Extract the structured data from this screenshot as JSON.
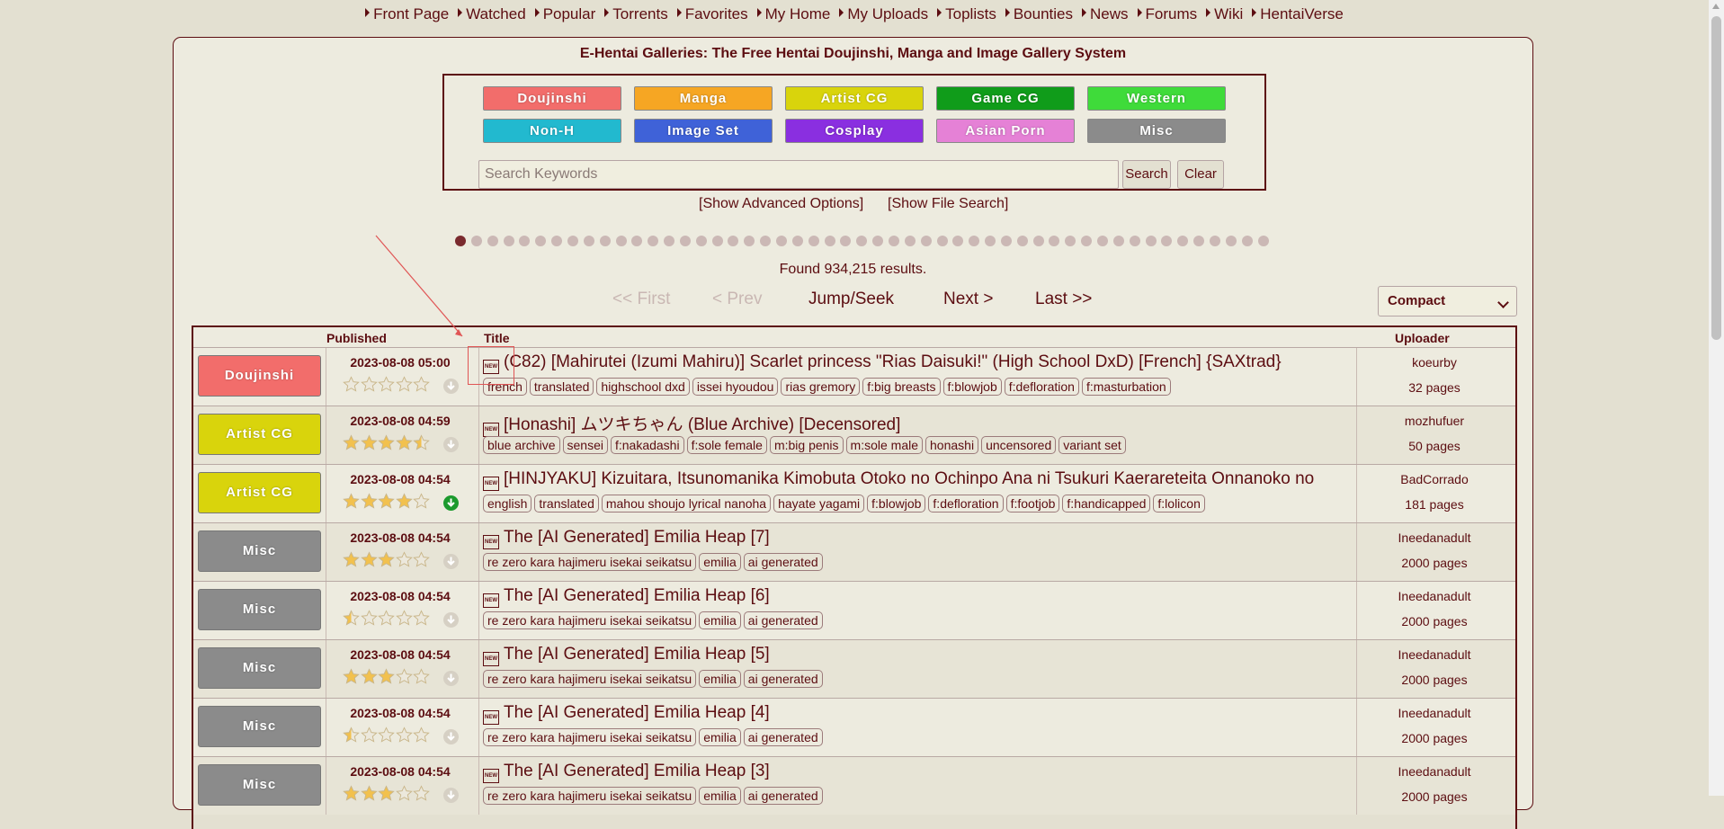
{
  "nav": [
    "Front Page",
    "Watched",
    "Popular",
    "Torrents",
    "Favorites",
    "My Home",
    "My Uploads",
    "Toplists",
    "Bounties",
    "News",
    "Forums",
    "Wiki",
    "HentaiVerse"
  ],
  "site_title": "E-Hentai Galleries: The Free Hentai Doujinshi, Manga and Image Gallery System",
  "categories": [
    {
      "label": "Doujinshi",
      "color": "#f26d6b"
    },
    {
      "label": "Manga",
      "color": "#f6a623"
    },
    {
      "label": "Artist CG",
      "color": "#d9d40c"
    },
    {
      "label": "Game CG",
      "color": "#109c1a"
    },
    {
      "label": "Western",
      "color": "#3fdb3a"
    },
    {
      "label": "Non-H",
      "color": "#22b9cf"
    },
    {
      "label": "Image Set",
      "color": "#3f62d8"
    },
    {
      "label": "Cosplay",
      "color": "#8a2fe0"
    },
    {
      "label": "Asian Porn",
      "color": "#e581d6"
    },
    {
      "label": "Misc",
      "color": "#8b8b8b"
    }
  ],
  "search": {
    "placeholder": "Search Keywords",
    "search_label": "Search",
    "clear_label": "Clear",
    "advanced": "[Show Advanced Options]",
    "file_search": "[Show File Search]"
  },
  "found": "Found 934,215 results.",
  "pager": {
    "first": "<< First",
    "prev": "< Prev",
    "jump": "Jump/Seek",
    "next": "Next >",
    "last": "Last >>"
  },
  "display_mode": "Compact",
  "columns": {
    "published": "Published",
    "title": "Title",
    "uploader": "Uploader"
  },
  "rows": [
    {
      "category": "Doujinshi",
      "color": "#f26d6b",
      "published": "2023-08-08 05:00",
      "rating": 0,
      "torrent": false,
      "title": "(C82) [Mahirutei (Izumi Mahiru)] Scarlet princess \"Rias Daisuki!\" (High School DxD) [French] {SAXtrad}",
      "tags": [
        "french",
        "translated",
        "highschool dxd",
        "issei hyoudou",
        "rias gremory",
        "f:big breasts",
        "f:blowjob",
        "f:defloration",
        "f:masturbation"
      ],
      "uploader": "koeurby",
      "pages": "32 pages"
    },
    {
      "category": "Artist CG",
      "color": "#d9d40c",
      "published": "2023-08-08 04:59",
      "rating": 4.5,
      "torrent": false,
      "title": "[Honashi] ムツキちゃん (Blue Archive) [Decensored]",
      "tags": [
        "blue archive",
        "sensei",
        "f:nakadashi",
        "f:sole female",
        "m:big penis",
        "m:sole male",
        "honashi",
        "uncensored",
        "variant set"
      ],
      "uploader": "mozhufuer",
      "pages": "50 pages"
    },
    {
      "category": "Artist CG",
      "color": "#d9d40c",
      "published": "2023-08-08 04:54",
      "rating": 4,
      "torrent": true,
      "title": "[HINJYAKU] Kizuitara, Itsunomanika Kimobuta Otoko no Ochinpo Ana ni Tsukuri Kaerareteita Onnanoko no",
      "tags": [
        "english",
        "translated",
        "mahou shoujo lyrical nanoha",
        "hayate yagami",
        "f:blowjob",
        "f:defloration",
        "f:footjob",
        "f:handicapped",
        "f:lolicon"
      ],
      "uploader": "BadCorrado",
      "pages": "181 pages"
    },
    {
      "category": "Misc",
      "color": "#8b8b8b",
      "published": "2023-08-08 04:54",
      "rating": 3,
      "torrent": false,
      "title": "The [AI Generated] Emilia Heap [7]",
      "tags": [
        "re zero kara hajimeru isekai seikatsu",
        "emilia",
        "ai generated"
      ],
      "uploader": "Ineedanadult",
      "pages": "2000 pages"
    },
    {
      "category": "Misc",
      "color": "#8b8b8b",
      "published": "2023-08-08 04:54",
      "rating": 0.5,
      "torrent": false,
      "title": "The [AI Generated] Emilia Heap [6]",
      "tags": [
        "re zero kara hajimeru isekai seikatsu",
        "emilia",
        "ai generated"
      ],
      "uploader": "Ineedanadult",
      "pages": "2000 pages"
    },
    {
      "category": "Misc",
      "color": "#8b8b8b",
      "published": "2023-08-08 04:54",
      "rating": 3,
      "torrent": false,
      "title": "The [AI Generated] Emilia Heap [5]",
      "tags": [
        "re zero kara hajimeru isekai seikatsu",
        "emilia",
        "ai generated"
      ],
      "uploader": "Ineedanadult",
      "pages": "2000 pages"
    },
    {
      "category": "Misc",
      "color": "#8b8b8b",
      "published": "2023-08-08 04:54",
      "rating": 0.5,
      "torrent": false,
      "title": "The [AI Generated] Emilia Heap [4]",
      "tags": [
        "re zero kara hajimeru isekai seikatsu",
        "emilia",
        "ai generated"
      ],
      "uploader": "Ineedanadult",
      "pages": "2000 pages"
    },
    {
      "category": "Misc",
      "color": "#8b8b8b",
      "published": "2023-08-08 04:54",
      "rating": 3,
      "torrent": false,
      "title": "The [AI Generated] Emilia Heap [3]",
      "tags": [
        "re zero kara hajimeru isekai seikatsu",
        "emilia",
        "ai generated"
      ],
      "uploader": "Ineedanadult",
      "pages": "2000 pages"
    }
  ]
}
